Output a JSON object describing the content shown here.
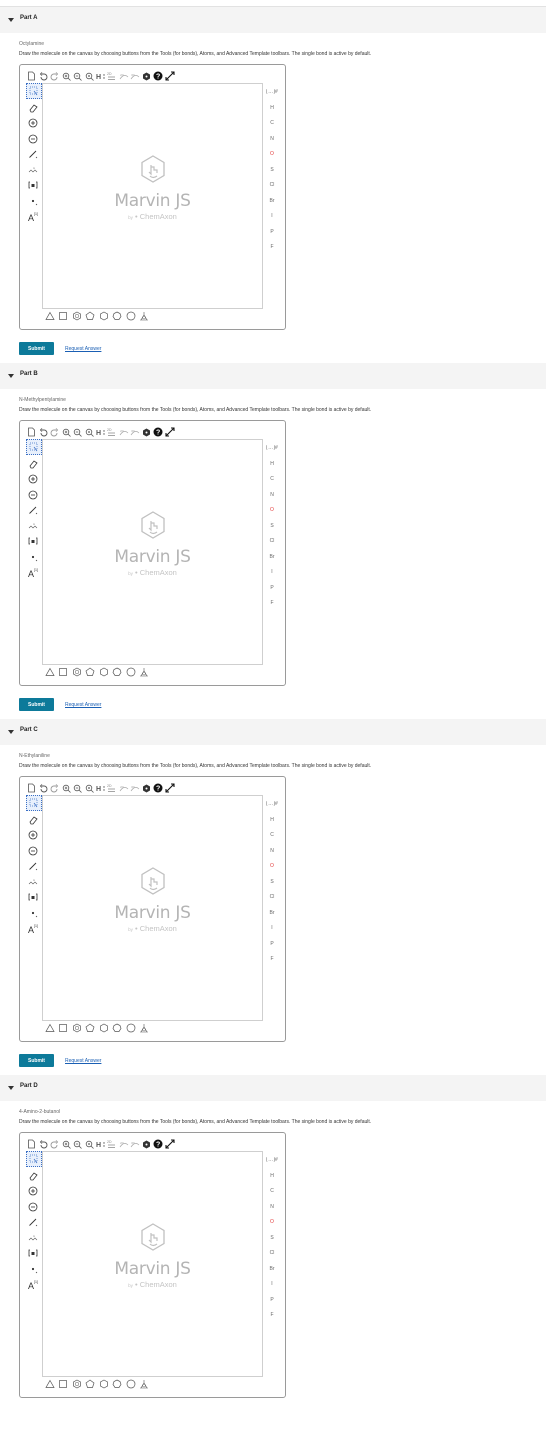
{
  "instruction": "Draw the molecule on the canvas by choosing buttons from the Tools (for bonds), Atoms, and Advanced Template toolbars. The single bond is active by default.",
  "submit_label": "Submit",
  "request_label": "Request Answer",
  "logo": {
    "name": "Marvin JS",
    "by": "by",
    "company": "ChemAxon"
  },
  "atoms": [
    "H",
    "C",
    "N",
    "O",
    "S",
    "Cl",
    "Br",
    "I",
    "P",
    "F"
  ],
  "atom_header": "⌊…⌋#",
  "left_tool_labels": {
    "charge_plus": "+",
    "charge_minus": "−",
    "rgroup": "R",
    "atom_A": "A"
  },
  "parts": [
    {
      "title": "Part A",
      "compound": "Octylamine"
    },
    {
      "title": "Part B",
      "compound": "N-Methylpentylamine"
    },
    {
      "title": "Part C",
      "compound": "N-Ethylaniline"
    },
    {
      "title": "Part D",
      "compound": "4-Amino-2-butanol"
    }
  ],
  "colors": {
    "accent": "#0d7a9a",
    "link": "#1a5fb4",
    "red_atom": "#e23b3b"
  }
}
